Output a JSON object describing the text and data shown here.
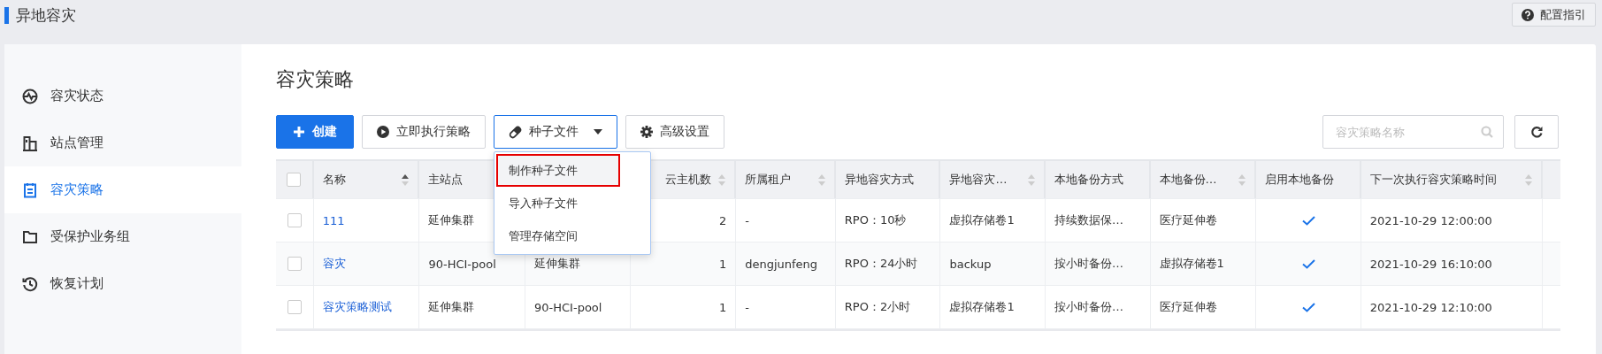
{
  "header": {
    "title": "异地容灾",
    "guide_button": "配置指引"
  },
  "sidebar": {
    "items": [
      {
        "label": "容灾状态",
        "selected": false
      },
      {
        "label": "站点管理",
        "selected": false
      },
      {
        "label": "容灾策略",
        "selected": true
      },
      {
        "label": "受保护业务组",
        "selected": false
      },
      {
        "label": "恢复计划",
        "selected": false
      }
    ]
  },
  "page_title": "容灾策略",
  "toolbar": {
    "buttons": [
      {
        "label": "创建",
        "kind": "primary"
      },
      {
        "label": "立即执行策略",
        "kind": "play"
      },
      {
        "label": "种子文件",
        "kind": "dropdown"
      },
      {
        "label": "高级设置",
        "kind": "gear"
      }
    ],
    "search": {
      "placeholder": "容灾策略名称"
    }
  },
  "dropdown_menu": {
    "items": [
      {
        "label": "制作种子文件",
        "selected": true
      },
      {
        "label": "导入种子文件",
        "selected": false
      },
      {
        "label": "管理存储空间",
        "selected": false
      }
    ]
  },
  "table": {
    "select_all_checked": false,
    "columns": [
      {
        "label": "名称",
        "sortable": true
      },
      {
        "label": "主站点",
        "sortable": false
      },
      {
        "label": "云主机数",
        "sortable": true
      },
      {
        "label": "所属租户",
        "sortable": true
      },
      {
        "label": "异地容灾方式",
        "sortable": false
      },
      {
        "label": "异地容灾…",
        "sortable": true
      },
      {
        "label": "本地备份方式",
        "sortable": false
      },
      {
        "label": "本地备份…",
        "sortable": true
      },
      {
        "label": "启用本地备份",
        "sortable": false
      },
      {
        "label": "下一次执行容灾策略时间",
        "sortable": true
      }
    ],
    "rows": [
      {
        "checked": false,
        "name": "111",
        "primary_site": "延伸集群",
        "column_3": null,
        "vm_count": "2",
        "tenant": "-",
        "remote_method": "RPO：10秒",
        "remote_target": "虚拟存储卷1",
        "local_method": "持续数据保…",
        "local_target": "医疗延伸卷",
        "local_backup_enabled": true,
        "next_run": "2021-10-29 12:00:00"
      },
      {
        "checked": false,
        "name": "容灾",
        "primary_site": "90-HCI-pool",
        "column_3": "延伸集群",
        "vm_count": "1",
        "tenant": "dengjunfeng",
        "remote_method": "RPO：24小时",
        "remote_target": "backup",
        "local_method": "按小时备份…",
        "local_target": "虚拟存储卷1",
        "local_backup_enabled": true,
        "next_run": "2021-10-29 16:10:00"
      },
      {
        "checked": false,
        "name": "容灾策略测试",
        "primary_site": "延伸集群",
        "column_3": "90-HCI-pool",
        "vm_count": "1",
        "tenant": "-",
        "remote_method": "RPO：2小时",
        "remote_target": "虚拟存储卷1",
        "local_method": "按小时备份…",
        "local_target": "医疗延伸卷",
        "local_backup_enabled": true,
        "next_run": "2021-10-29 12:10:00"
      }
    ]
  }
}
